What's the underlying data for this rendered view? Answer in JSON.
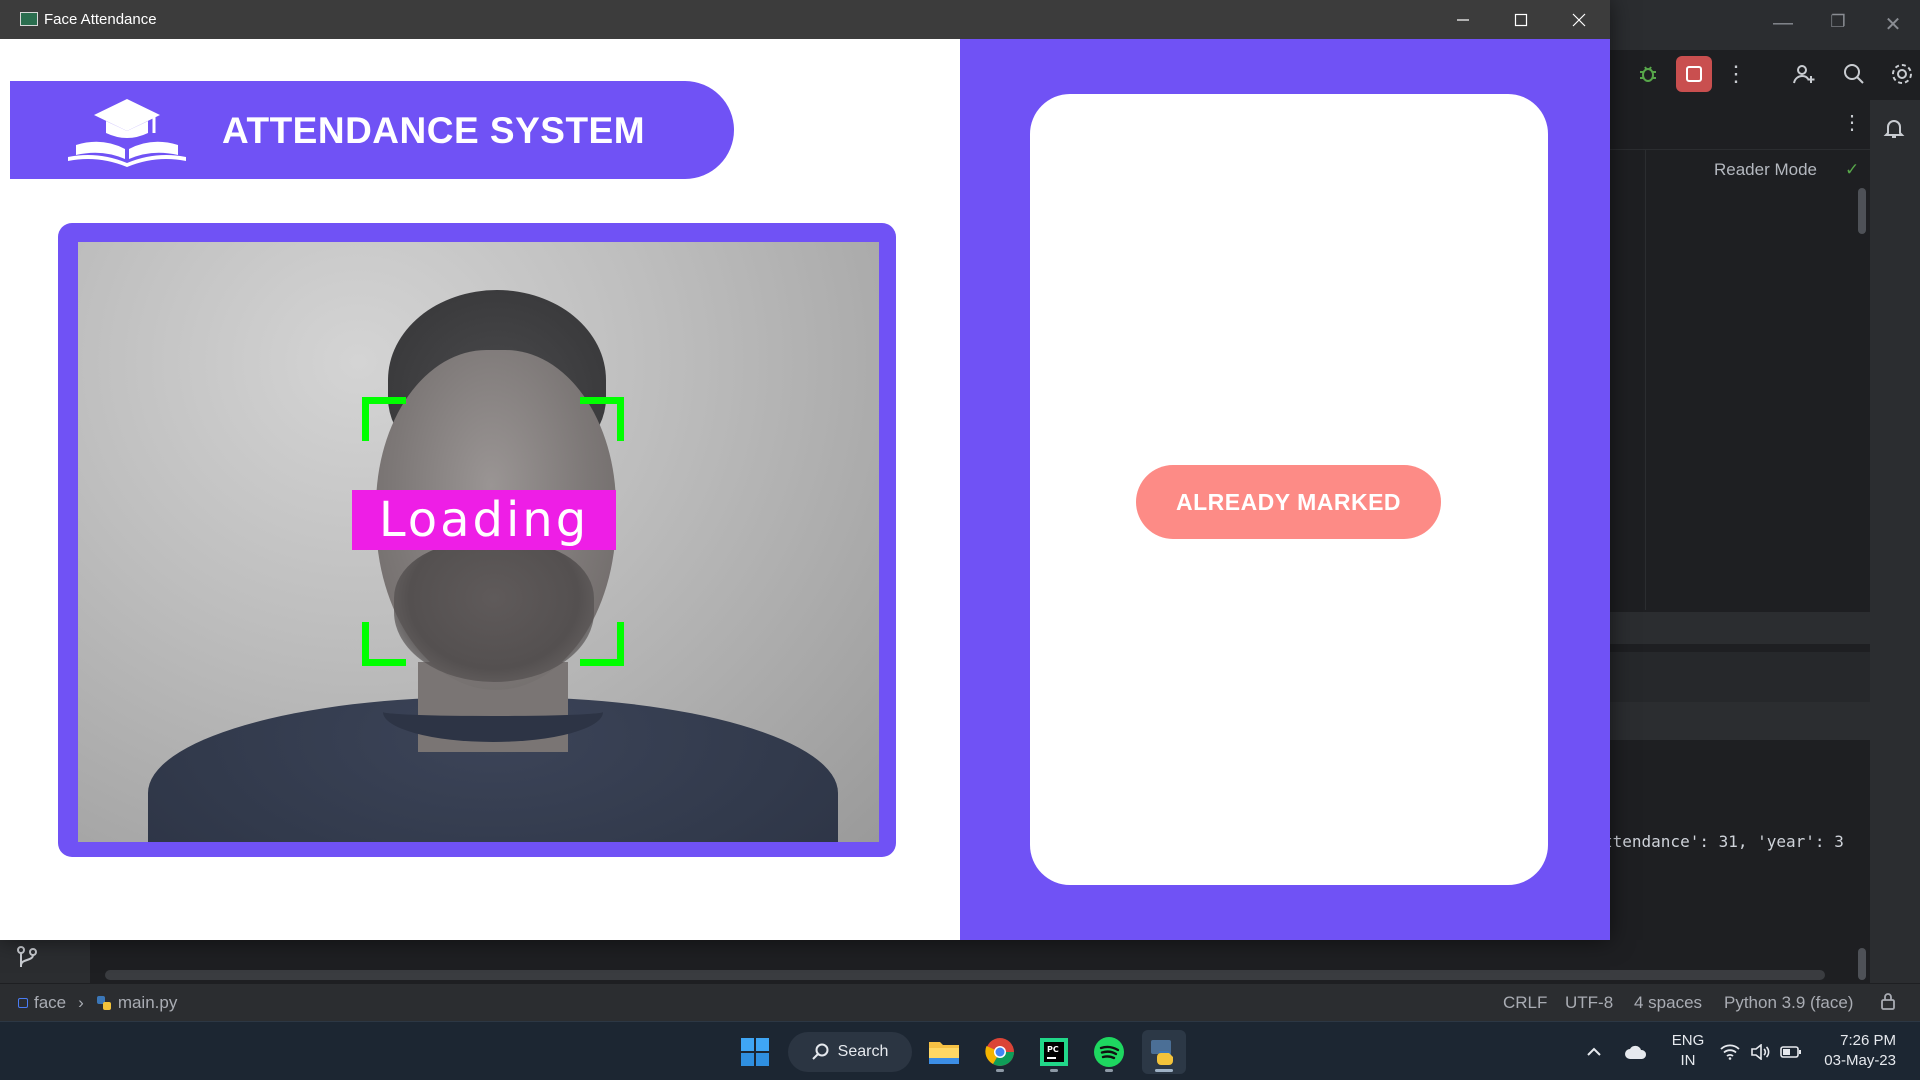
{
  "window": {
    "title": "Face Attendance",
    "controls": {
      "minimize": "minimize",
      "maximize": "maximize",
      "close": "close"
    }
  },
  "app": {
    "banner_title": "ATTENDANCE SYSTEM",
    "camera_overlay_text": "Loading",
    "status_label": "ALREADY MARKED",
    "colors": {
      "primary": "#7052f5",
      "status": "#fd8b86",
      "face_box": "#00ff00",
      "overlay": "#ee1ee6"
    }
  },
  "ide": {
    "reader_mode": "Reader Mode",
    "console_line": "ttendance': 31, 'year': 3",
    "statusbar": {
      "project": "face",
      "file": "main.py",
      "line_ending": "CRLF",
      "encoding": "UTF-8",
      "indent": "4 spaces",
      "interpreter": "Python 3.9 (face)"
    }
  },
  "taskbar": {
    "search_label": "Search",
    "apps": [
      "start-icon",
      "file-explorer-icon",
      "chrome-icon",
      "pycharm-icon",
      "spotify-icon",
      "python-icon"
    ],
    "language": {
      "line1": "ENG",
      "line2": "IN"
    },
    "time": "7:26 PM",
    "date": "03-May-23"
  }
}
